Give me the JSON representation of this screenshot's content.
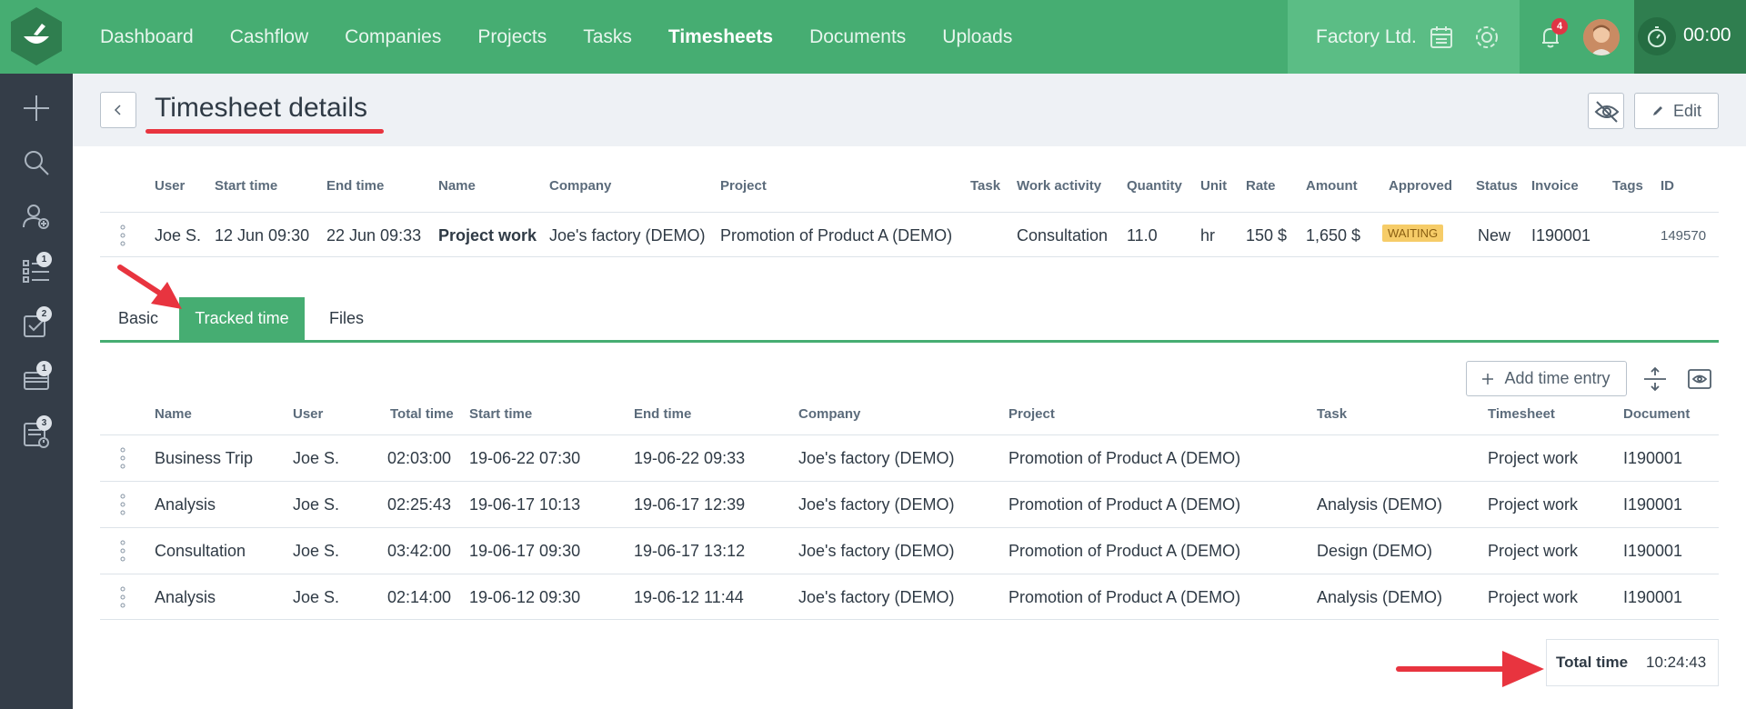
{
  "topbar": {
    "nav": [
      "Dashboard",
      "Cashflow",
      "Companies",
      "Projects",
      "Tasks",
      "Timesheets",
      "Documents",
      "Uploads"
    ],
    "active_nav": "Timesheets",
    "company": "Factory Ltd.",
    "notification_count": "4",
    "timer": "00:00",
    "icons": [
      "calendar-icon",
      "gear-icon",
      "bell-icon",
      "stopwatch-icon"
    ]
  },
  "sidebar": {
    "items": [
      {
        "icon": "plus-icon",
        "badge": ""
      },
      {
        "icon": "search-icon",
        "badge": ""
      },
      {
        "icon": "add-user-icon",
        "badge": ""
      },
      {
        "icon": "task-list-icon",
        "badge": "1"
      },
      {
        "icon": "checkbox-icon",
        "badge": "2"
      },
      {
        "icon": "card-icon",
        "badge": "1"
      },
      {
        "icon": "timesheet-icon",
        "badge": "3"
      }
    ]
  },
  "header": {
    "title": "Timesheet details",
    "edit_label": "Edit"
  },
  "summary": {
    "columns": [
      "User",
      "Start time",
      "End time",
      "Name",
      "Company",
      "Project",
      "Task",
      "Work activity",
      "Quantity",
      "Unit",
      "Rate",
      "Amount",
      "Approved",
      "Status",
      "Invoice",
      "Tags",
      "ID"
    ],
    "row": {
      "user": "Joe S.",
      "start_time": "12 Jun 09:30",
      "end_time": "22 Jun 09:33",
      "name": "Project work",
      "company": "Joe's factory (DEMO)",
      "project": "Promotion of Product A (DEMO)",
      "task": "",
      "work_activity": "Consultation",
      "quantity": "11.0",
      "unit": "hr",
      "rate": "150 $",
      "amount": "1,650 $",
      "approved": "WAITING",
      "status": "New",
      "invoice": "I190001",
      "tags": "",
      "id": "149570"
    }
  },
  "tabs": [
    "Basic",
    "Tracked time",
    "Files"
  ],
  "active_tab": "Tracked time",
  "tracked": {
    "add_label": "Add time entry",
    "columns": [
      "Name",
      "User",
      "Total time",
      "Start time",
      "End time",
      "Company",
      "Project",
      "Task",
      "Timesheet",
      "Document"
    ],
    "rows": [
      [
        "Business Trip",
        "Joe S.",
        "02:03:00",
        "19-06-22 07:30",
        "19-06-22 09:33",
        "Joe's factory (DEMO)",
        "Promotion of Product A (DEMO)",
        "",
        "Project work",
        "I190001"
      ],
      [
        "Analysis",
        "Joe S.",
        "02:25:43",
        "19-06-17 10:13",
        "19-06-17 12:39",
        "Joe's factory (DEMO)",
        "Promotion of Product A (DEMO)",
        "Analysis (DEMO)",
        "Project work",
        "I190001"
      ],
      [
        "Consultation",
        "Joe S.",
        "03:42:00",
        "19-06-17 09:30",
        "19-06-17 13:12",
        "Joe's factory (DEMO)",
        "Promotion of Product A (DEMO)",
        "Design (DEMO)",
        "Project work",
        "I190001"
      ],
      [
        "Analysis",
        "Joe S.",
        "02:14:00",
        "19-06-12 09:30",
        "19-06-12 11:44",
        "Joe's factory (DEMO)",
        "Promotion of Product A (DEMO)",
        "Analysis (DEMO)",
        "Project work",
        "I190001"
      ]
    ],
    "total_label": "Total time",
    "total_value": "10:24:43"
  },
  "colors": {
    "brand_green": "#46ad72",
    "sidebar": "#343d48",
    "annotation_red": "#e8343f",
    "waiting_badge": "#f6cc68"
  }
}
